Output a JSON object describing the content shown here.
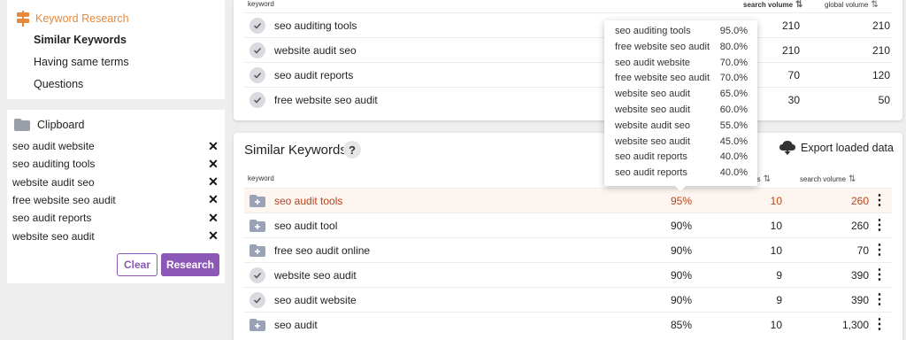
{
  "sidebar": {
    "section_title": "Keyword Research",
    "items": [
      "Similar Keywords",
      "Having same terms",
      "Questions"
    ],
    "active_item": "Similar Keywords"
  },
  "clipboard": {
    "title": "Clipboard",
    "items": [
      "seo audit website",
      "seo auditing tools",
      "website audit seo",
      "free website seo audit",
      "seo audit reports",
      "website seo audit"
    ],
    "clear_label": "Clear",
    "research_label": "Research",
    "accent_color": "#8b58b8"
  },
  "top_table": {
    "col_keyword": "keyword",
    "col_search_volume": "search volume",
    "col_global_volume": "global volume",
    "rows": [
      {
        "keyword": "seo auditing tools",
        "search_volume": "210",
        "global_volume": "210"
      },
      {
        "keyword": "website audit seo",
        "search_volume": "210",
        "global_volume": "210"
      },
      {
        "keyword": "seo audit reports",
        "search_volume": "70",
        "global_volume": "120"
      },
      {
        "keyword": "free website seo audit",
        "search_volume": "30",
        "global_volume": "50"
      }
    ]
  },
  "similar": {
    "title": "Similar Keywords",
    "help": "?",
    "export_label": "Export loaded data",
    "col_keyword": "keyword",
    "col_words": "ords",
    "col_search_volume": "search volume",
    "highlight_color": "#b5451b",
    "rows": [
      {
        "keyword": "seo audit tools",
        "similarity": "95%",
        "words": "10",
        "search_volume": "260",
        "highlighted": true,
        "icon": "folder-plus"
      },
      {
        "keyword": "seo audit tool",
        "similarity": "90%",
        "words": "10",
        "search_volume": "260",
        "highlighted": false,
        "icon": "folder-plus"
      },
      {
        "keyword": "free seo audit online",
        "similarity": "90%",
        "words": "10",
        "search_volume": "70",
        "highlighted": false,
        "icon": "folder-plus"
      },
      {
        "keyword": "website seo audit",
        "similarity": "90%",
        "words": "9",
        "search_volume": "390",
        "highlighted": false,
        "icon": "check"
      },
      {
        "keyword": "seo audit website",
        "similarity": "90%",
        "words": "9",
        "search_volume": "390",
        "highlighted": false,
        "icon": "check"
      },
      {
        "keyword": "seo audit",
        "similarity": "85%",
        "words": "10",
        "search_volume": "1,300",
        "highlighted": false,
        "icon": "folder-plus"
      }
    ]
  },
  "tooltip": {
    "rows": [
      {
        "keyword": "seo auditing tools",
        "value": "95.0%"
      },
      {
        "keyword": "free website seo audit",
        "value": "80.0%"
      },
      {
        "keyword": "seo audit website",
        "value": "70.0%"
      },
      {
        "keyword": "free website seo audit",
        "value": "70.0%"
      },
      {
        "keyword": "website seo audit",
        "value": "65.0%"
      },
      {
        "keyword": "website seo audit",
        "value": "60.0%"
      },
      {
        "keyword": "website audit seo",
        "value": "55.0%"
      },
      {
        "keyword": "website seo audit",
        "value": "45.0%"
      },
      {
        "keyword": "seo audit reports",
        "value": "40.0%"
      },
      {
        "keyword": "seo audit reports",
        "value": "40.0%"
      }
    ]
  }
}
